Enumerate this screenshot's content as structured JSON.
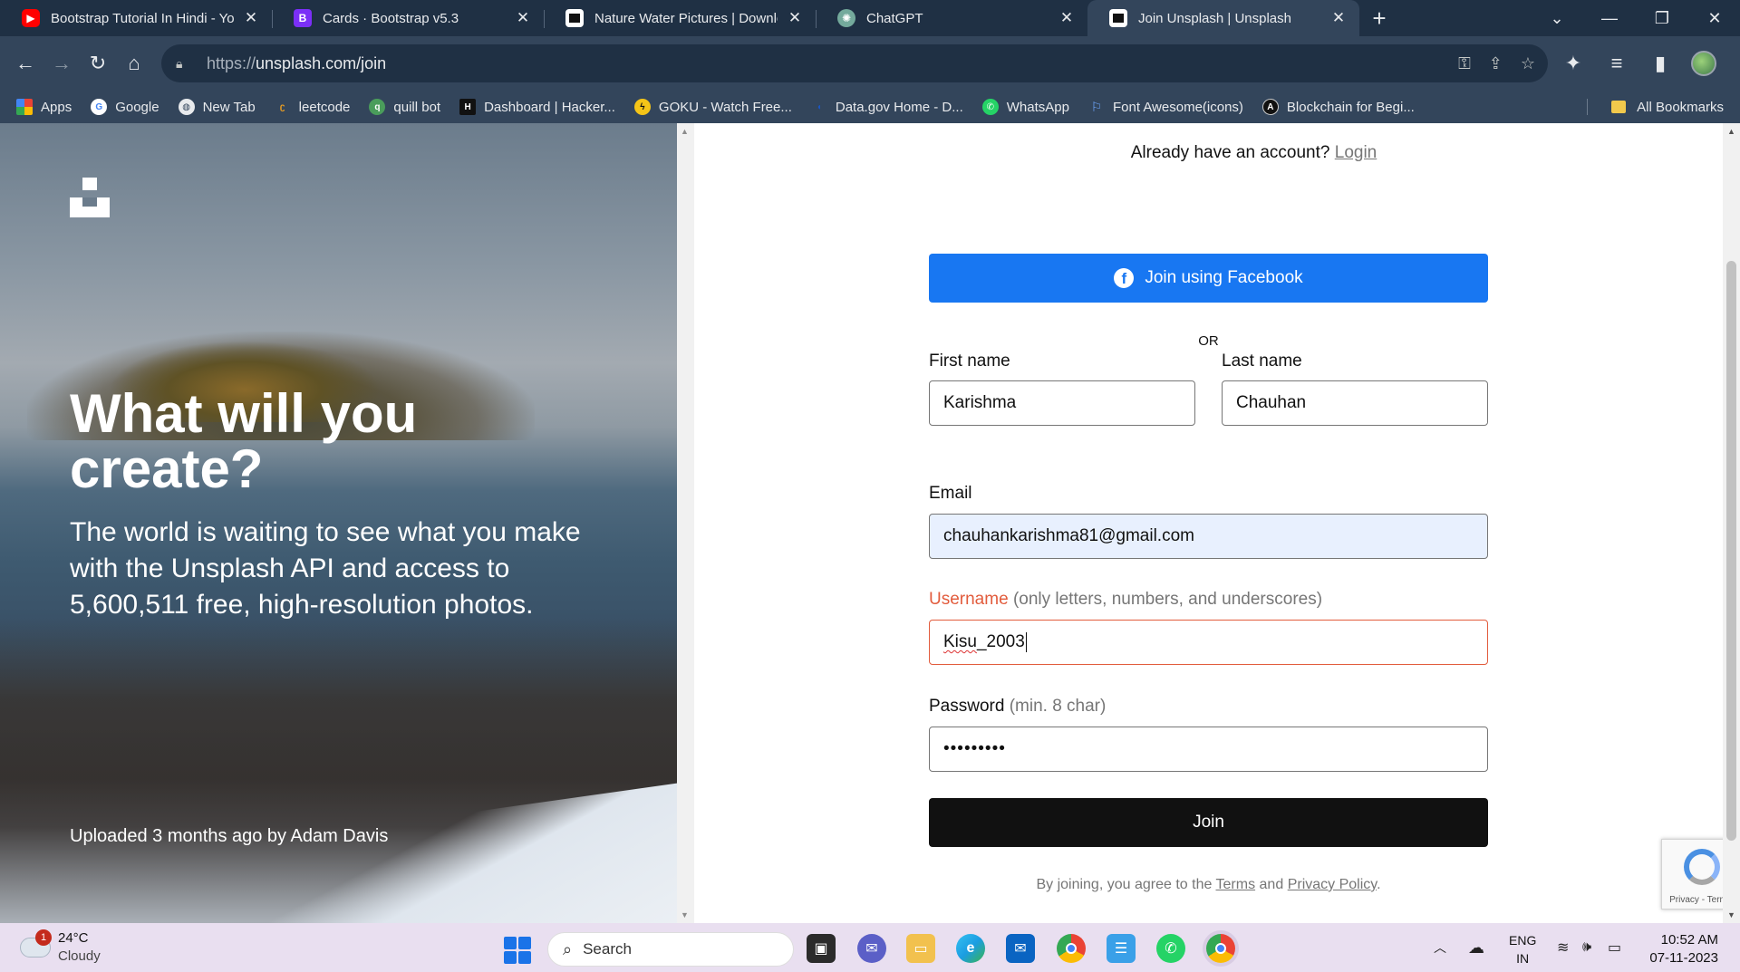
{
  "tabs": [
    {
      "title": "Bootstrap Tutorial In Hindi - You",
      "icon": "youtube-icon",
      "active": false
    },
    {
      "title": "Cards · Bootstrap v5.3",
      "icon": "bootstrap-icon",
      "active": false
    },
    {
      "title": "Nature Water Pictures | Downloa",
      "icon": "unsplash-icon",
      "active": false
    },
    {
      "title": "ChatGPT",
      "icon": "chatgpt-icon",
      "active": false
    },
    {
      "title": "Join Unsplash | Unsplash",
      "icon": "unsplash-icon",
      "active": true
    }
  ],
  "address_bar": {
    "protocol": "https://",
    "url": "unsplash.com/join"
  },
  "bookmarks": [
    {
      "label": "Apps",
      "icon": "apps-grid-icon"
    },
    {
      "label": "Google",
      "icon": "google-icon"
    },
    {
      "label": "New Tab",
      "icon": "globe-icon"
    },
    {
      "label": "leetcode",
      "icon": "leetcode-icon"
    },
    {
      "label": "quill bot",
      "icon": "quillbot-icon"
    },
    {
      "label": "Dashboard | Hacker...",
      "icon": "hackerrank-icon"
    },
    {
      "label": "GOKU - Watch Free...",
      "icon": "goku-icon"
    },
    {
      "label": "Data.gov Home - D...",
      "icon": "datagov-icon"
    },
    {
      "label": "WhatsApp",
      "icon": "whatsapp-icon"
    },
    {
      "label": "Font Awesome(icons)",
      "icon": "flag-icon"
    },
    {
      "label": "Blockchain for Begi...",
      "icon": "blockchain-icon"
    }
  ],
  "all_bookmarks_label": "All Bookmarks",
  "hero": {
    "title": "What will you create?",
    "subtitle": "The world is waiting to see what you make with the Unsplash API and access to 5,600,511 free, high-resolution photos.",
    "credit": "Uploaded 3 months ago by Adam Davis"
  },
  "form": {
    "have_account_text": "Already have an account?",
    "login_link": "Login",
    "facebook_button": "Join using Facebook",
    "or_text": "OR",
    "first_name": {
      "label": "First name",
      "value": "Karishma"
    },
    "last_name": {
      "label": "Last name",
      "value": "Chauhan"
    },
    "email": {
      "label": "Email",
      "value": "chauhankarishma81@gmail.com"
    },
    "username": {
      "label": "Username",
      "hint": "(only letters, numbers, and underscores)",
      "value_part1": "Kisu",
      "value_part2": "_2003"
    },
    "password": {
      "label": "Password",
      "hint": "(min. 8 char)",
      "value": "•••••••••"
    },
    "join_button": "Join",
    "legal_prefix": "By joining, you agree to the",
    "terms_link": "Terms",
    "legal_and": "and",
    "privacy_link": "Privacy Policy",
    "legal_suffix": "."
  },
  "recaptcha_text": "Privacy - Terms",
  "taskbar": {
    "weather_temp": "24°C",
    "weather_desc": "Cloudy",
    "weather_badge": "1",
    "search_placeholder": "Search",
    "lang_top": "ENG",
    "lang_bottom": "IN",
    "time": "10:52 AM",
    "date": "07-11-2023"
  },
  "colors": {
    "facebook_blue": "#1877f2",
    "error_red": "#e25c3d",
    "join_black": "#111111",
    "chrome_dark": "#1f3044",
    "chrome_toolbar": "#33455b"
  }
}
